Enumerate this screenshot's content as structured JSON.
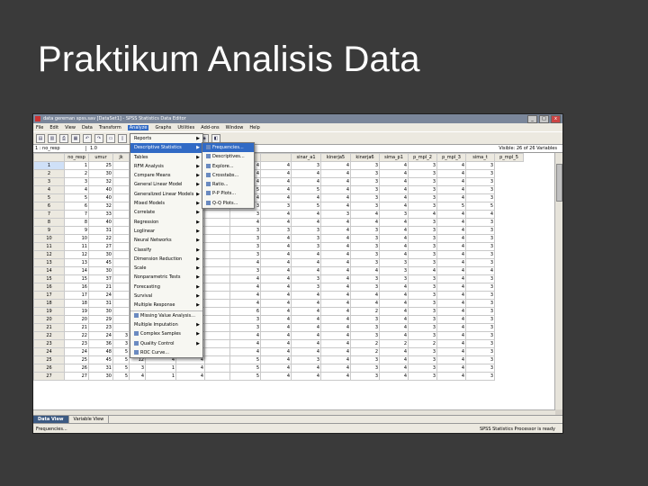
{
  "slide": {
    "title": "Praktikum Analisis Data"
  },
  "window": {
    "title": "data gereman spss.sav [DataSet1] - SPSS Statistics Data Editor",
    "controls": {
      "minimize": "_",
      "maximize": "□",
      "close": "x"
    }
  },
  "menubar": [
    "File",
    "Edit",
    "View",
    "Data",
    "Transform",
    "Analyze",
    "Graphs",
    "Utilities",
    "Add-ons",
    "Window",
    "Help"
  ],
  "menubar_active_index": 5,
  "toolbar_icons": [
    "open-icon",
    "save-icon",
    "print-icon",
    "dialog-recall-icon",
    "undo-icon",
    "redo-icon",
    "goto-case-icon",
    "variables-icon",
    "find-icon",
    "insert-cases-icon",
    "insert-variable-icon",
    "split-file-icon",
    "weight-cases-icon",
    "select-cases-icon",
    "value-labels-icon",
    "use-sets-icon"
  ],
  "toolbar_glyphs": [
    "▤",
    "▥",
    "⎙",
    "▦",
    "↶",
    "↷",
    "▭",
    "▯",
    "⚲",
    "≡",
    "⫴",
    "◫",
    "⚖",
    "☷",
    "◈",
    "◧"
  ],
  "cellbar": {
    "ref": "1 : no_resp",
    "value": "1.0",
    "visible": "Visible: 26 of 26 Variables"
  },
  "grid": {
    "headers": [
      "no_resp",
      "umur",
      "jk",
      "",
      "",
      "",
      "",
      "",
      "",
      "sinar_a1",
      "kinerja5",
      "kinerja6",
      "sima_p1",
      "p_mpl_2",
      "p_mpl_3",
      "sima_t",
      "p_mpl_5"
    ],
    "rows": [
      [
        "1",
        "1",
        "25",
        "",
        "",
        "",
        "",
        "",
        "4",
        "4",
        "3",
        "4",
        "3",
        "4",
        "3",
        "4",
        "3"
      ],
      [
        "2",
        "2",
        "30",
        "",
        "",
        "",
        "",
        "",
        "4",
        "4",
        "4",
        "4",
        "3",
        "4",
        "3",
        "4",
        "3"
      ],
      [
        "3",
        "3",
        "32",
        "",
        "",
        "",
        "",
        "",
        "4",
        "4",
        "4",
        "4",
        "3",
        "4",
        "3",
        "4",
        "3"
      ],
      [
        "4",
        "4",
        "40",
        "",
        "",
        "",
        "",
        "",
        "5",
        "4",
        "5",
        "4",
        "3",
        "4",
        "3",
        "4",
        "3"
      ],
      [
        "5",
        "5",
        "40",
        "",
        "",
        "",
        "",
        "",
        "4",
        "4",
        "4",
        "4",
        "3",
        "4",
        "3",
        "4",
        "3"
      ],
      [
        "6",
        "6",
        "32",
        "",
        "",
        "",
        "",
        "",
        "3",
        "3",
        "5",
        "4",
        "3",
        "4",
        "3",
        "5",
        "5"
      ],
      [
        "7",
        "7",
        "33",
        "",
        "",
        "",
        "",
        "",
        "3",
        "4",
        "4",
        "3",
        "4",
        "3",
        "4",
        "4",
        "4"
      ],
      [
        "8",
        "8",
        "40",
        "",
        "",
        "",
        "",
        "",
        "4",
        "4",
        "4",
        "4",
        "4",
        "4",
        "3",
        "4",
        "3"
      ],
      [
        "9",
        "9",
        "31",
        "",
        "",
        "",
        "",
        "",
        "3",
        "3",
        "3",
        "4",
        "3",
        "4",
        "3",
        "4",
        "3"
      ],
      [
        "10",
        "10",
        "22",
        "",
        "",
        "",
        "",
        "",
        "3",
        "4",
        "3",
        "4",
        "3",
        "4",
        "3",
        "4",
        "3"
      ],
      [
        "11",
        "11",
        "27",
        "",
        "",
        "",
        "",
        "",
        "3",
        "4",
        "3",
        "4",
        "3",
        "4",
        "3",
        "4",
        "3"
      ],
      [
        "12",
        "12",
        "30",
        "",
        "",
        "",
        "",
        "",
        "3",
        "4",
        "4",
        "4",
        "3",
        "4",
        "3",
        "4",
        "3"
      ],
      [
        "13",
        "13",
        "45",
        "",
        "",
        "",
        "",
        "",
        "4",
        "4",
        "4",
        "4",
        "3",
        "3",
        "3",
        "4",
        "3"
      ],
      [
        "14",
        "14",
        "30",
        "",
        "",
        "",
        "",
        "",
        "3",
        "4",
        "4",
        "4",
        "4",
        "3",
        "4",
        "4",
        "4"
      ],
      [
        "15",
        "15",
        "37",
        "",
        "",
        "",
        "",
        "",
        "4",
        "4",
        "3",
        "4",
        "3",
        "3",
        "3",
        "4",
        "3"
      ],
      [
        "16",
        "16",
        "21",
        "",
        "",
        "",
        "",
        "",
        "4",
        "4",
        "3",
        "4",
        "3",
        "4",
        "3",
        "4",
        "3"
      ],
      [
        "17",
        "17",
        "24",
        "",
        "",
        "",
        "",
        "",
        "4",
        "4",
        "4",
        "4",
        "4",
        "4",
        "3",
        "4",
        "3"
      ],
      [
        "18",
        "18",
        "31",
        "",
        "",
        "",
        "",
        "",
        "4",
        "4",
        "4",
        "4",
        "4",
        "4",
        "3",
        "4",
        "3"
      ],
      [
        "19",
        "19",
        "30",
        "",
        "",
        "",
        "",
        "",
        "6",
        "4",
        "4",
        "4",
        "2",
        "4",
        "3",
        "4",
        "3"
      ],
      [
        "20",
        "20",
        "29",
        "",
        "",
        "",
        "",
        "",
        "3",
        "4",
        "4",
        "4",
        "3",
        "4",
        "3",
        "4",
        "3"
      ],
      [
        "21",
        "21",
        "23",
        "",
        "",
        "",
        "",
        "",
        "3",
        "4",
        "4",
        "4",
        "3",
        "4",
        "3",
        "4",
        "3"
      ],
      [
        "22",
        "22",
        "24",
        "3",
        "2",
        "",
        "",
        "",
        "4",
        "4",
        "4",
        "4",
        "3",
        "4",
        "3",
        "4",
        "3"
      ],
      [
        "23",
        "23",
        "36",
        "3",
        "2",
        "4",
        "4",
        "",
        "4",
        "4",
        "4",
        "4",
        "2",
        "2",
        "2",
        "4",
        "3"
      ],
      [
        "24",
        "24",
        "48",
        "5",
        "10",
        "1",
        "4",
        "",
        "4",
        "4",
        "4",
        "4",
        "2",
        "4",
        "3",
        "4",
        "3"
      ],
      [
        "25",
        "25",
        "45",
        "5",
        "12",
        "4",
        "4",
        "",
        "5",
        "4",
        "3",
        "4",
        "3",
        "4",
        "3",
        "4",
        "3"
      ],
      [
        "26",
        "26",
        "31",
        "5",
        "3",
        "1",
        "4",
        "",
        "5",
        "4",
        "4",
        "4",
        "3",
        "4",
        "3",
        "4",
        "3"
      ],
      [
        "27",
        "27",
        "30",
        "5",
        "4",
        "1",
        "4",
        "",
        "5",
        "4",
        "4",
        "4",
        "3",
        "4",
        "3",
        "4",
        "3"
      ]
    ]
  },
  "analyze_menu": [
    "Reports",
    "Descriptive Statistics",
    "Tables",
    "RFM Analysis",
    "Compare Means",
    "General Linear Model",
    "Generalized Linear Models",
    "Mixed Models",
    "Correlate",
    "Regression",
    "Loglinear",
    "Neural Networks",
    "Classify",
    "Dimension Reduction",
    "Scale",
    "Nonparametric Tests",
    "Forecasting",
    "Survival",
    "Multiple Response",
    "Missing Value Analysis...",
    "Multiple Imputation",
    "Complex Samples",
    "Quality Control",
    "ROC Curve..."
  ],
  "analyze_menu_submenu_flags": [
    true,
    true,
    true,
    true,
    true,
    true,
    true,
    true,
    true,
    true,
    true,
    true,
    true,
    true,
    true,
    true,
    true,
    true,
    true,
    false,
    true,
    true,
    true,
    false
  ],
  "analyze_menu_highlighted": 1,
  "descriptive_submenu": [
    "Frequencies...",
    "Descriptives...",
    "Explore...",
    "Crosstabs...",
    "Ratio...",
    "P-P Plots...",
    "Q-Q Plots..."
  ],
  "descriptive_submenu_highlighted": 0,
  "tabs": [
    "Data View",
    "Variable View"
  ],
  "active_tab": 0,
  "status": {
    "left": "Frequencies...",
    "right": "SPSS Statistics  Processor is ready"
  }
}
